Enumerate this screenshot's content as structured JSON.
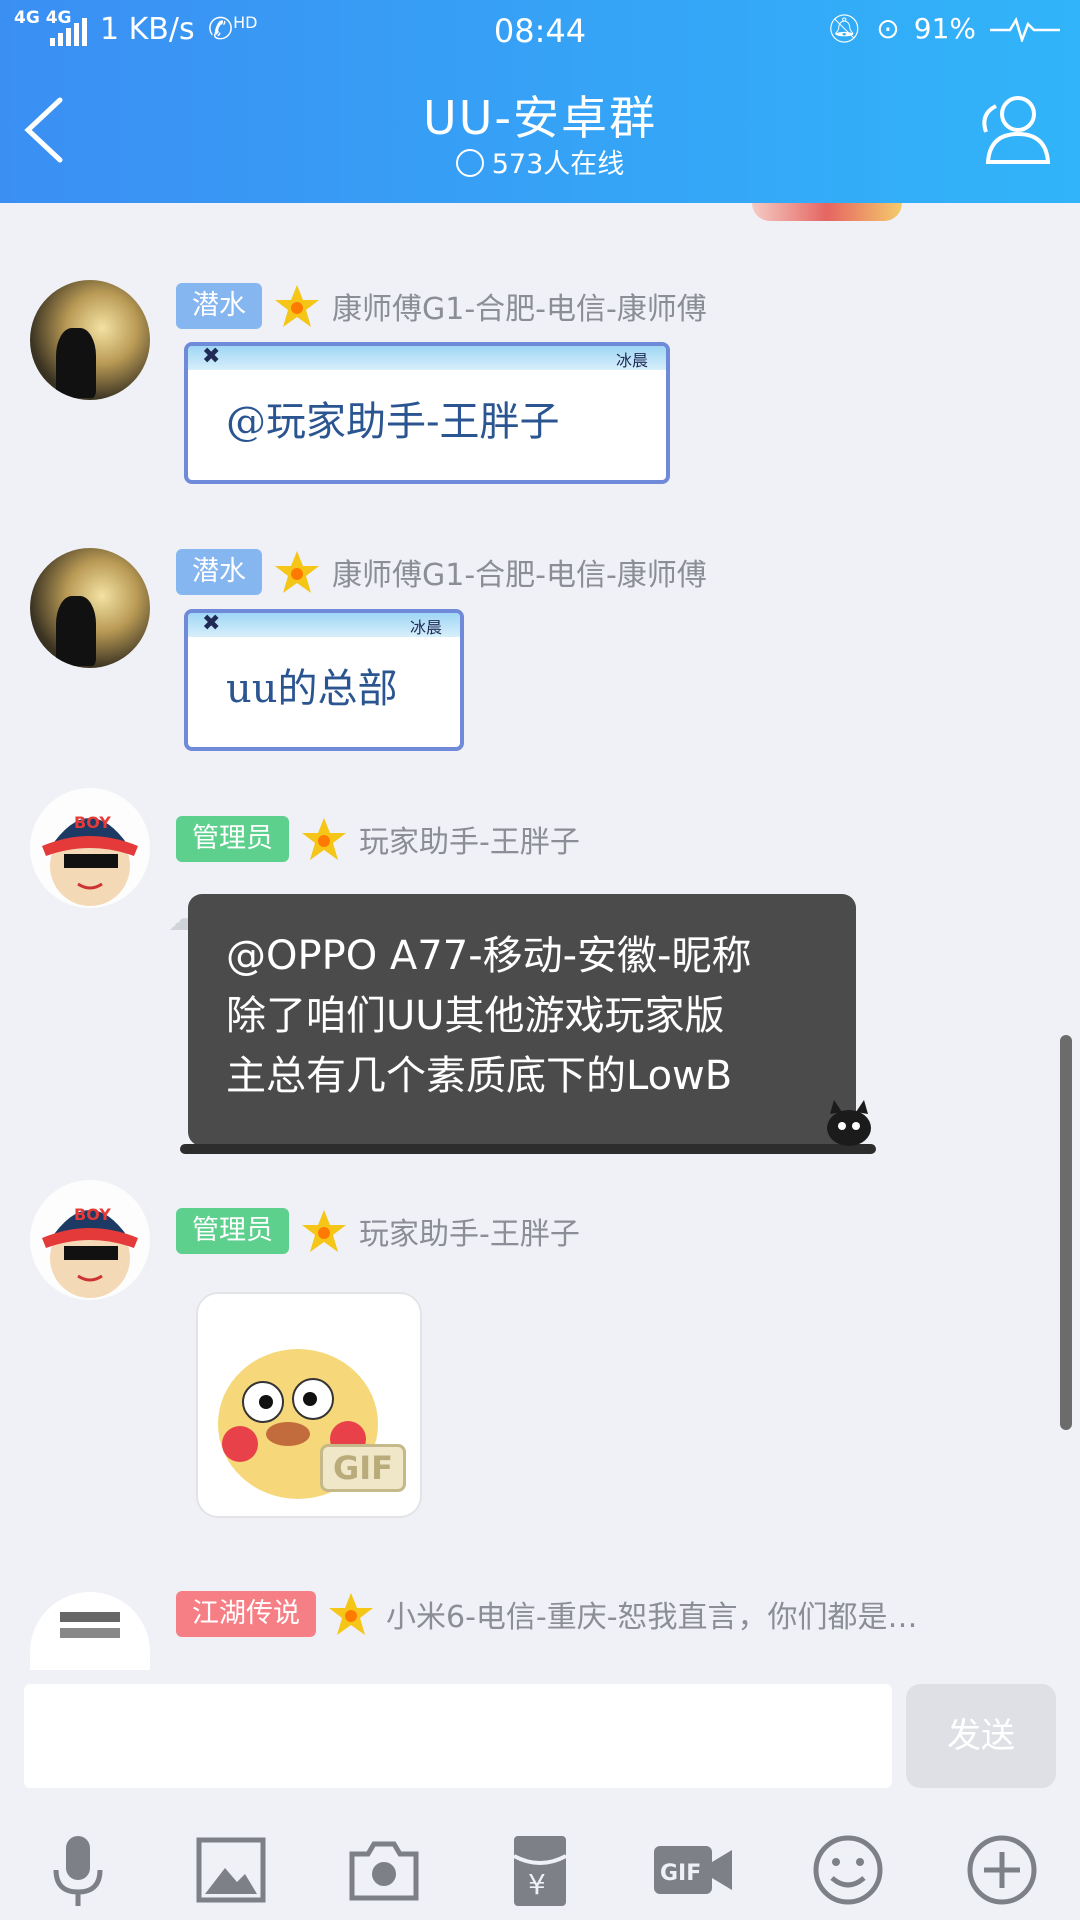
{
  "status_bar": {
    "network": "4G 4G",
    "speed": "1 KB/s",
    "hd": "HD",
    "time": "08:44",
    "battery": "91%"
  },
  "header": {
    "title": "UU-安卓群",
    "online": "573人在线",
    "back_icon": "back-chevron-icon",
    "profile_icon": "group-members-icon",
    "color_start": "#3b8ff3",
    "color_end": "#31b4f9"
  },
  "messages": [
    {
      "badge": "潜水",
      "badge_color": "#86b6f0",
      "nickname": "康师傅G1-合肥-电信-康师傅",
      "card_brand": "冰晨",
      "text": "@玩家助手-王胖子"
    },
    {
      "badge": "潜水",
      "badge_color": "#86b6f0",
      "nickname": "康师傅G1-合肥-电信-康师傅",
      "card_brand": "冰晨",
      "text": "uu的总部"
    },
    {
      "badge": "管理员",
      "badge_color": "#5cd08c",
      "nickname": "玩家助手-王胖子",
      "lines": [
        "@OPPO A77-移动-安徽-昵称",
        "除了咱们UU其他游戏玩家版",
        "主总有几个素质底下的LowB"
      ]
    },
    {
      "badge": "管理员",
      "badge_color": "#5cd08c",
      "nickname": "玩家助手-王胖子",
      "gif_label": "GIF"
    },
    {
      "badge": "江湖传说",
      "badge_color": "#f67f86",
      "nickname": "小米6-电信-重庆-恕我直言，你们都是…"
    }
  ],
  "composer": {
    "input_value": "",
    "send_label": "发送"
  },
  "toolbar": {
    "icons": [
      "microphone-icon",
      "image-icon",
      "camera-icon",
      "red-packet-icon",
      "gif-video-icon",
      "emoji-icon",
      "plus-icon"
    ]
  }
}
